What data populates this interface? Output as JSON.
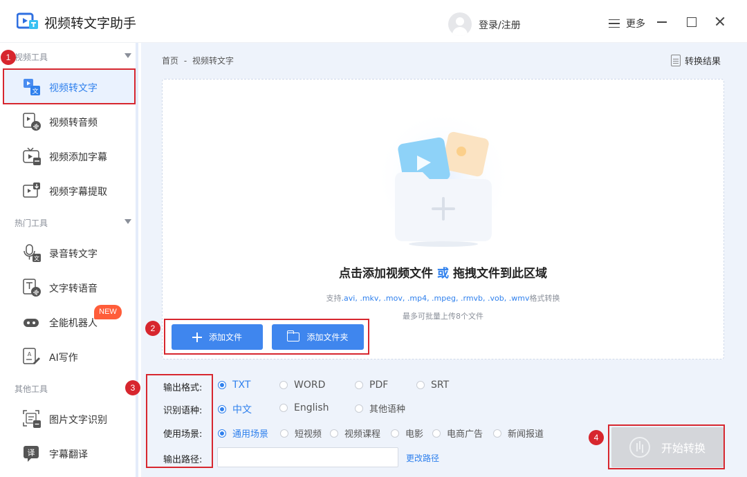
{
  "app": {
    "title": "视频转文字助手",
    "login": "登录/注册",
    "more": "更多"
  },
  "sidebar": {
    "sections": [
      {
        "title": "视频工具",
        "items": [
          {
            "label": "视频转文字",
            "icon": "video-to-text-icon",
            "active": true
          },
          {
            "label": "视频转音频",
            "icon": "video-to-audio-icon"
          },
          {
            "label": "视频添加字幕",
            "icon": "video-add-subtitle-icon"
          },
          {
            "label": "视频字幕提取",
            "icon": "video-subtitle-extract-icon"
          }
        ]
      },
      {
        "title": "热门工具",
        "items": [
          {
            "label": "录音转文字",
            "icon": "microphone-icon"
          },
          {
            "label": "文字转语音",
            "icon": "text-to-speech-icon"
          },
          {
            "label": "全能机器人",
            "icon": "robot-icon",
            "badge": "NEW"
          },
          {
            "label": "AI写作",
            "icon": "ai-writing-icon"
          }
        ]
      },
      {
        "title": "其他工具",
        "items": [
          {
            "label": "图片文字识别",
            "icon": "image-ocr-icon"
          },
          {
            "label": "字幕翻译",
            "icon": "subtitle-translate-icon"
          }
        ]
      }
    ]
  },
  "main": {
    "breadcrumb": [
      "首页",
      "-",
      "视频转文字"
    ],
    "result_link": "转换结果",
    "dropzone": {
      "title_part1": "点击添加视频文件",
      "title_accent": "或",
      "title_part2": "拖拽文件到此区域",
      "support_prefix": "支持",
      "support_exts": ".avi, .mkv, .mov, .mp4, .mpeg, .rmvb, .vob, .wmv",
      "support_suffix": "格式转换",
      "limit": "最多可批量上传8个文件"
    },
    "add_file": "添加文件",
    "add_folder": "添加文件夹",
    "output_format": {
      "label": "输出格式:",
      "options": [
        "TXT",
        "WORD",
        "PDF",
        "SRT"
      ],
      "selected": "TXT"
    },
    "language": {
      "label": "识别语种:",
      "options": [
        "中文",
        "English",
        "其他语种"
      ],
      "selected": "中文"
    },
    "scene": {
      "label": "使用场景:",
      "options": [
        "通用场景",
        "短视频",
        "视频课程",
        "电影",
        "电商广告",
        "新闻报道"
      ],
      "selected": "通用场景"
    },
    "output_path": {
      "label": "输出路径:",
      "value": "",
      "change": "更改路径"
    },
    "start": "开始转换"
  },
  "annotations": [
    "1",
    "2",
    "3",
    "4"
  ],
  "colors": {
    "accent": "#2f80ed",
    "button": "#3f86ee",
    "annotation": "#d7262e",
    "badge": "#ff5d3a"
  }
}
